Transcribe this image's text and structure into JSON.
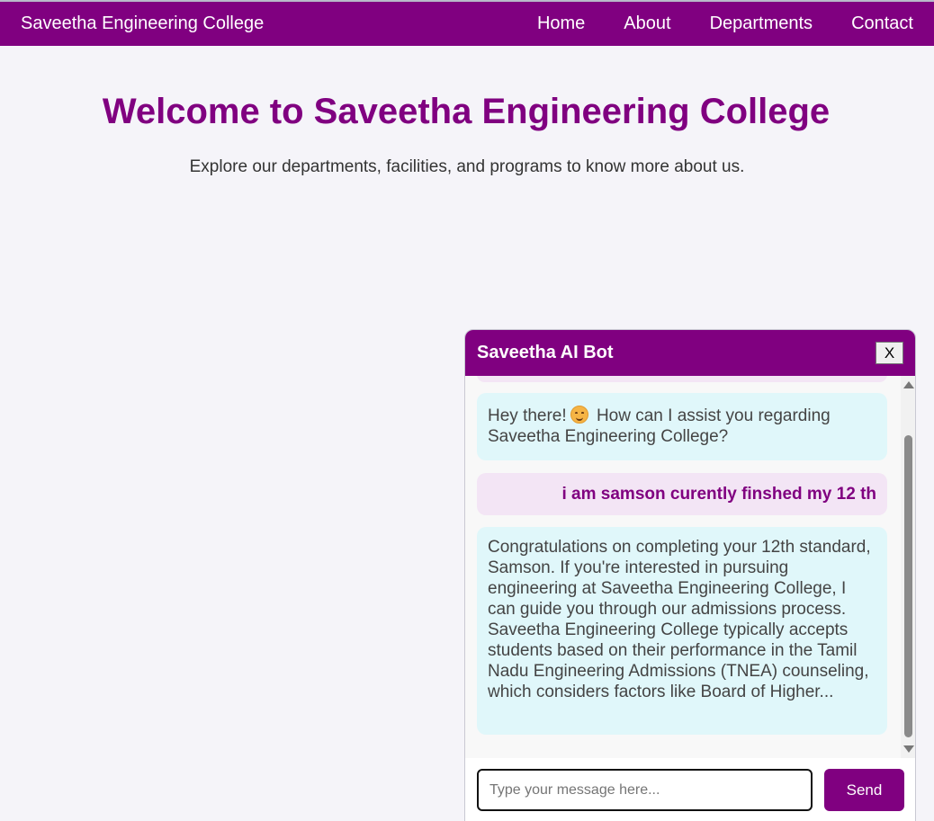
{
  "navbar": {
    "brand": "Saveetha Engineering College",
    "links": [
      "Home",
      "About",
      "Departments",
      "Contact"
    ]
  },
  "hero": {
    "title": "Welcome to Saveetha Engineering College",
    "subtitle": "Explore our departments, facilities, and programs to know more about us."
  },
  "chat": {
    "title": "Saveetha AI Bot",
    "close_label": "X",
    "messages": [
      {
        "role": "bot",
        "before_emoji": "Hey there!",
        "emoji": "smiling-face-emoji",
        "after_emoji": "How can I assist you regarding Saveetha Engineering College?"
      },
      {
        "role": "user",
        "text": "i am samson curently finshed my 12 th"
      },
      {
        "role": "bot",
        "text": "Congratulations on completing your 12th standard, Samson. If you're interested in pursuing engineering at Saveetha Engineering College, I can guide you through our admissions process. Saveetha Engineering College typically accepts students based on their performance in the Tamil Nadu Engineering Admissions (TNEA) counseling, which considers factors like Board of Higher..."
      }
    ],
    "input": {
      "value": "",
      "placeholder": "Type your message here..."
    },
    "send_label": "Send"
  },
  "colors": {
    "brand": "#800080",
    "bot_bubble": "#e0f7fa",
    "user_bubble": "#f3e5f5",
    "page_bg": "#f5f4f9"
  }
}
